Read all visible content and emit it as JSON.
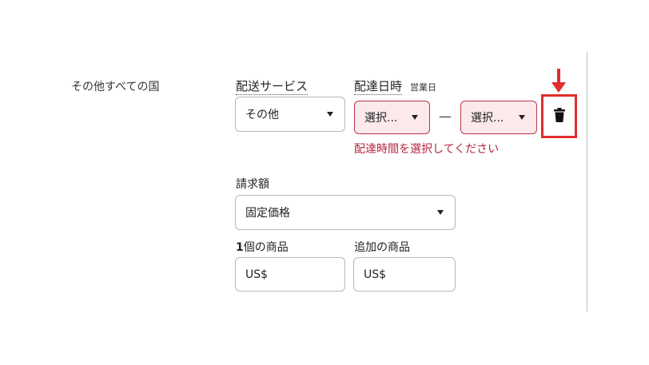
{
  "region": {
    "label": "その他すべての国"
  },
  "shipping_service": {
    "label": "配送サービス",
    "selected": "その他"
  },
  "delivery_time": {
    "label": "配達日時",
    "sublabel": "営業日",
    "from_placeholder": "選択...",
    "separator": "—",
    "to_placeholder": "選択...",
    "error": "配達時間を選択してください"
  },
  "billing": {
    "label": "請求額",
    "selected": "固定価格"
  },
  "first_item": {
    "label_number": "1",
    "label_text": "個の商品",
    "value": "US$"
  },
  "additional_item": {
    "label": "追加の商品",
    "value": "US$"
  },
  "colors": {
    "error": "#b3263c",
    "error_bg": "#fbe9ec",
    "annotation": "#e02d2d"
  },
  "icons": {
    "delete": "trash-icon",
    "annotation": "down-arrow-icon"
  }
}
